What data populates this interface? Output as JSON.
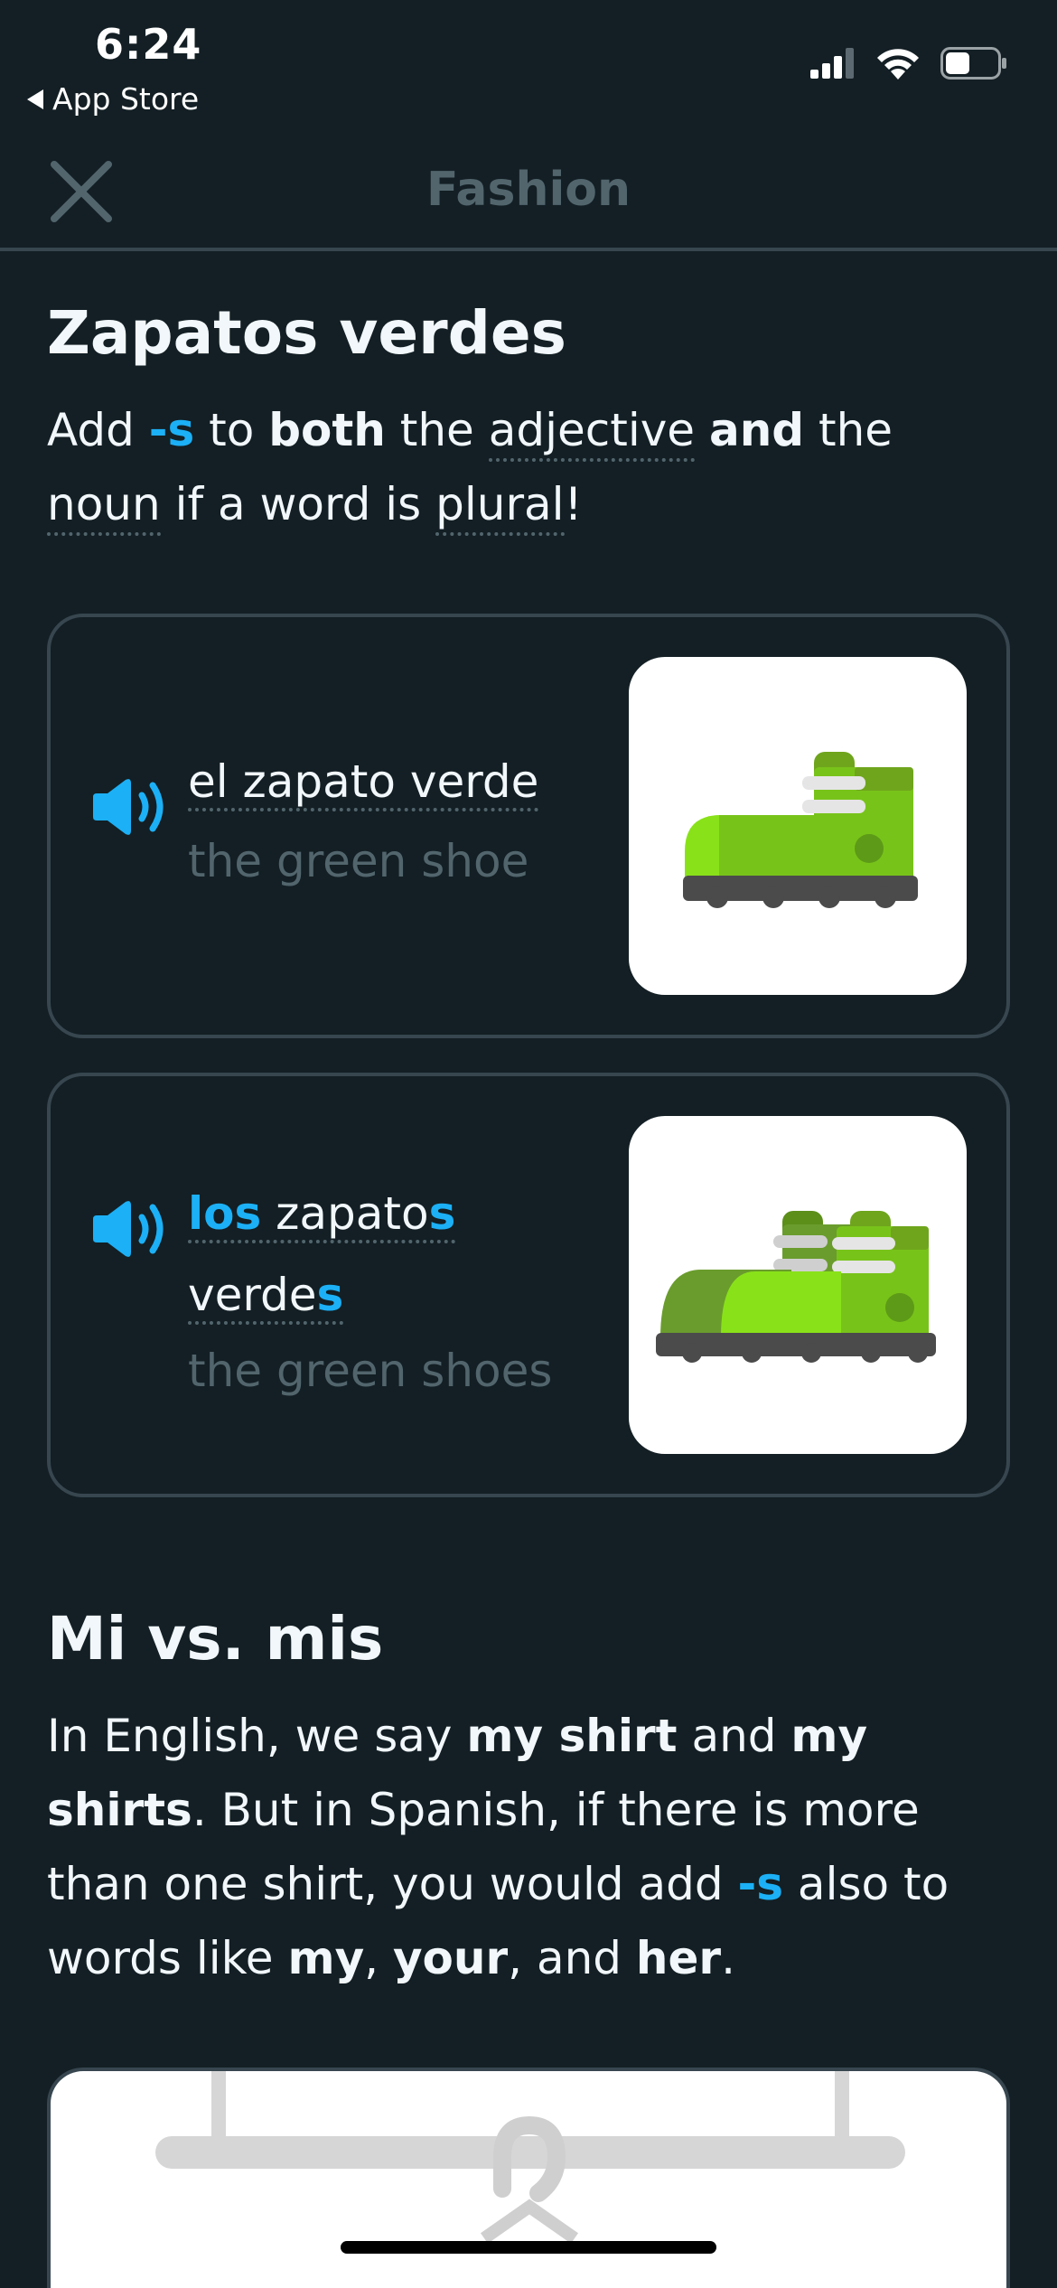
{
  "status_bar": {
    "time": "6:24",
    "back_label": "App Store"
  },
  "header": {
    "title": "Fashion"
  },
  "section1": {
    "title": "Zapatos verdes",
    "para": [
      "Add ",
      "-s",
      " to ",
      "both",
      " the ",
      "adjective",
      " ",
      "and",
      " the ",
      "noun",
      " if a word is ",
      "plural",
      "!"
    ]
  },
  "card1": {
    "es": [
      "el zapato verde"
    ],
    "en": "the green shoe"
  },
  "card2": {
    "es_parts": [
      "los",
      " zapato",
      "s",
      "verde",
      "s"
    ],
    "en": "the green shoes"
  },
  "section2": {
    "title": "Mi vs. mis",
    "para": [
      "In English, we say ",
      "my shirt",
      " and ",
      "my shirts",
      ". But in Spanish, if there is more than one shirt, you would add ",
      "-s",
      " also to words like ",
      "my",
      ", ",
      "your",
      ", and ",
      "her",
      "."
    ]
  },
  "colors": {
    "background": "#131f24",
    "accent_blue": "#1cb0f6",
    "muted": "#52656d",
    "border": "#37464f",
    "shoe_green": "#89e219"
  }
}
